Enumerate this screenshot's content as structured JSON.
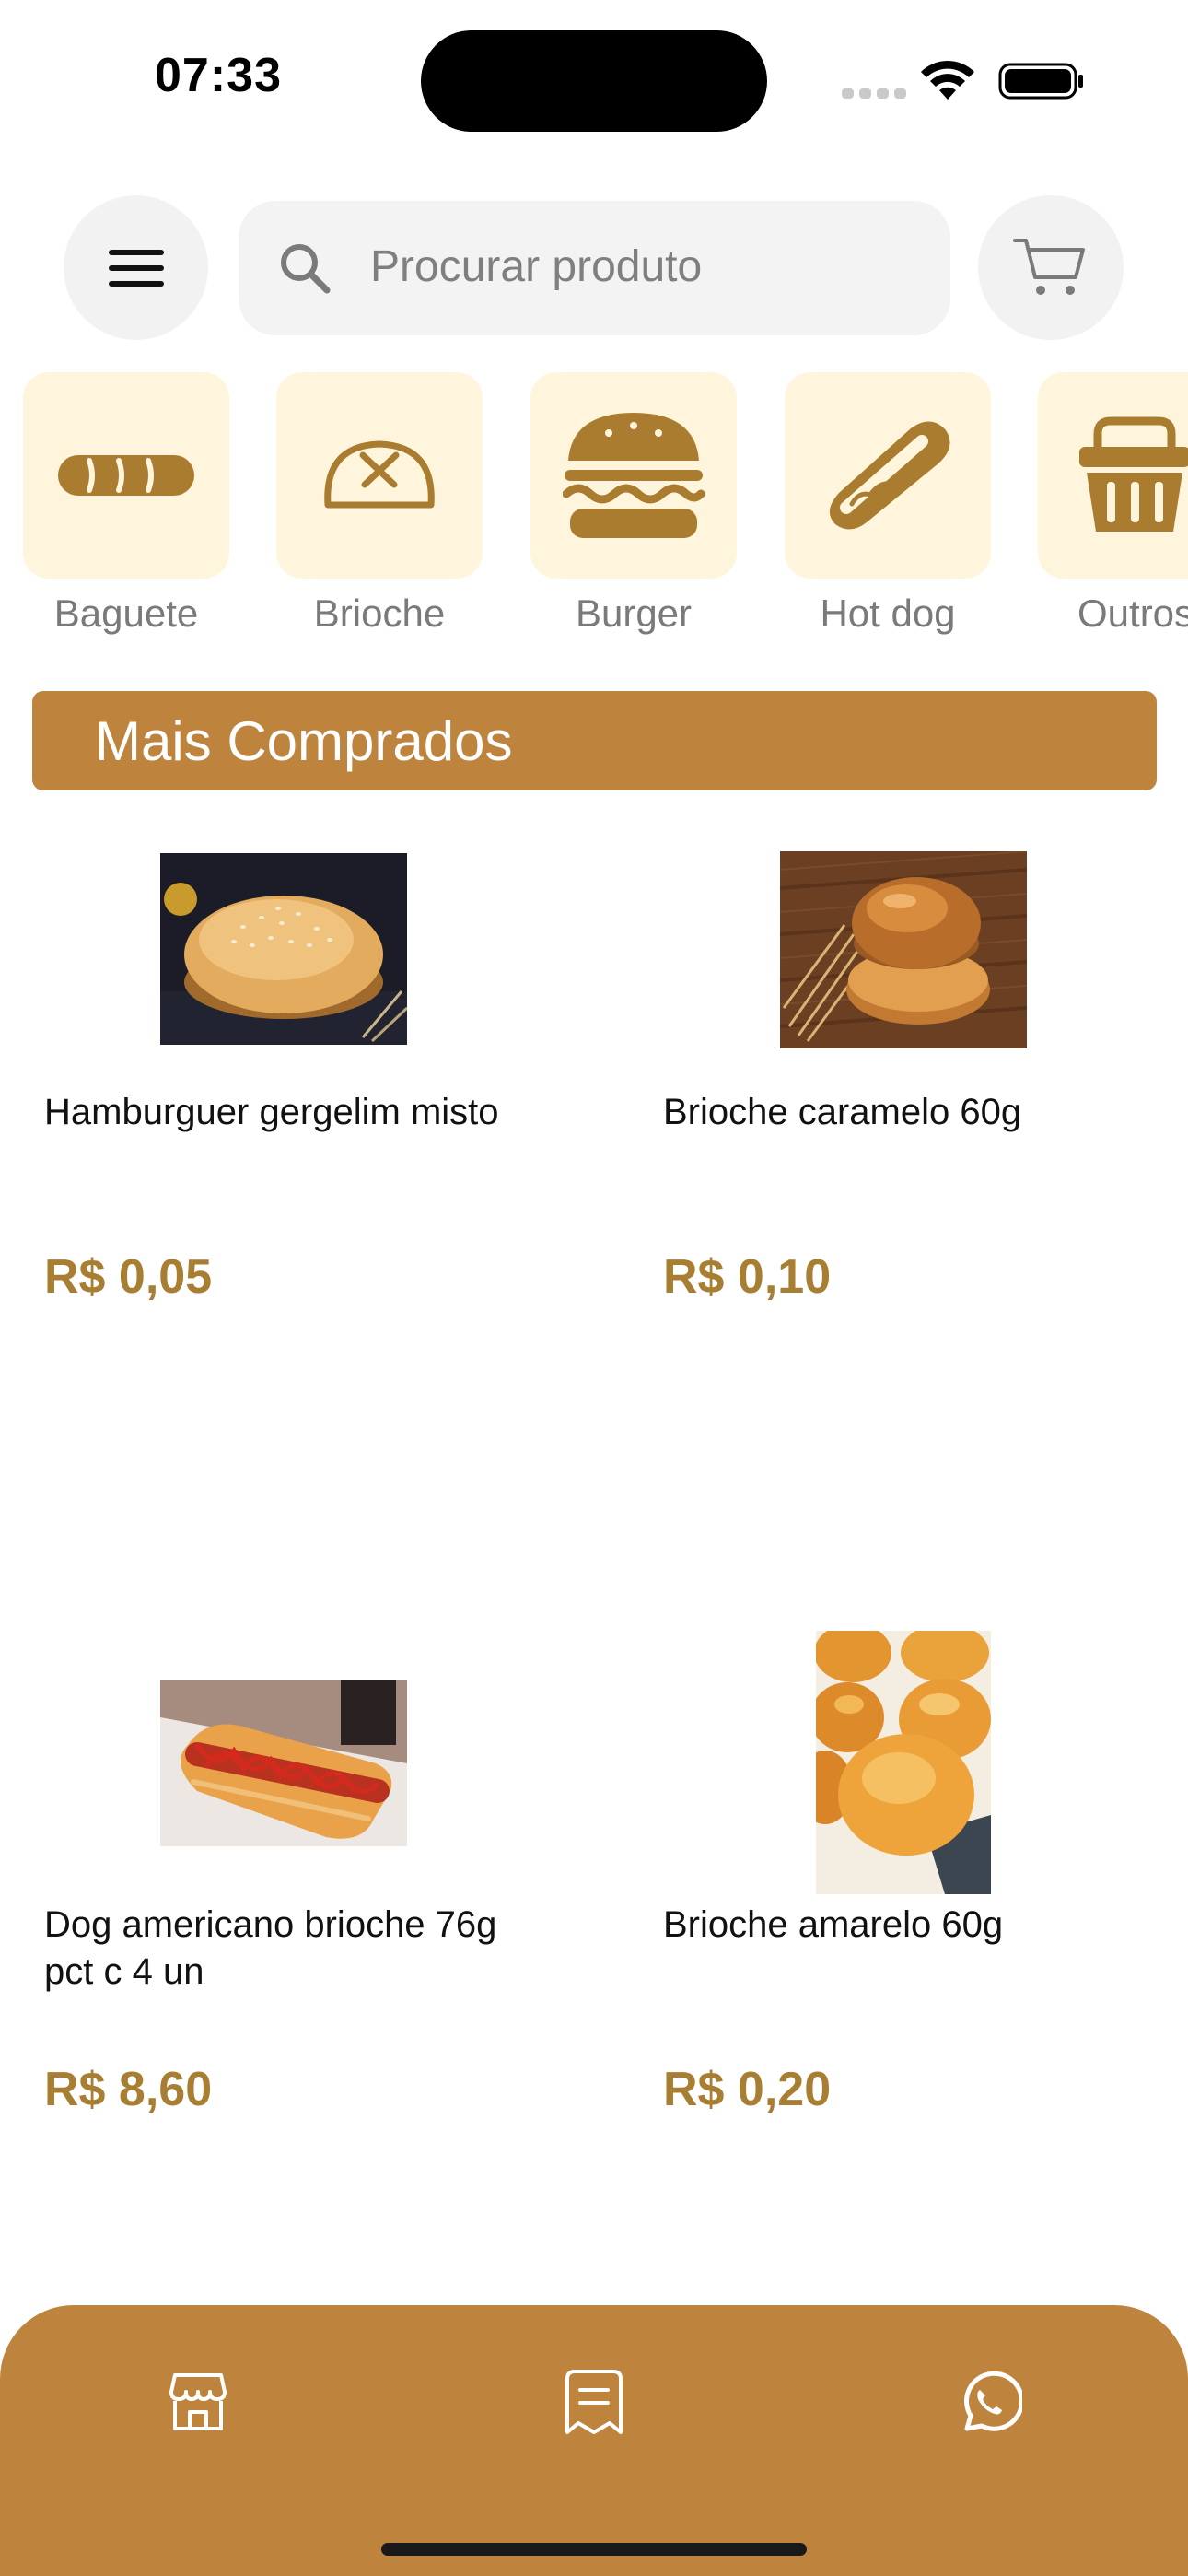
{
  "status_bar": {
    "time": "07:33"
  },
  "header": {
    "menu_icon": "hamburger-menu-icon",
    "search": {
      "placeholder": "Procurar produto",
      "icon": "search-icon"
    },
    "cart_icon": "cart-icon"
  },
  "categories": [
    {
      "label": "Baguete",
      "icon": "baguette-icon"
    },
    {
      "label": "Brioche",
      "icon": "brioche-icon"
    },
    {
      "label": "Burger",
      "icon": "burger-icon"
    },
    {
      "label": "Hot dog",
      "icon": "hotdog-icon"
    },
    {
      "label": "Outros",
      "icon": "basket-icon"
    }
  ],
  "section": {
    "title": "Mais Comprados"
  },
  "products": [
    {
      "name": "Hamburguer gergelim misto",
      "price": "R$ 0,05",
      "image": "sesame-burger-bun-photo"
    },
    {
      "name": "Brioche caramelo 60g",
      "price": "R$ 0,10",
      "image": "brioche-caramel-photo"
    },
    {
      "name": "Dog americano brioche 76g  pct c 4 un",
      "price": "R$ 8,60",
      "image": "hotdog-brioche-photo"
    },
    {
      "name": "Brioche amarelo 60g",
      "price": "R$ 0,20",
      "image": "brioche-yellow-photo"
    }
  ],
  "bottom_nav": [
    {
      "icon": "store-icon"
    },
    {
      "icon": "orders-receipt-icon"
    },
    {
      "icon": "whatsapp-icon"
    }
  ],
  "colors": {
    "accent": "#be843e",
    "price": "#a87f32",
    "category_tile": "#fff5dc",
    "icon_brown": "#a97c2f"
  }
}
